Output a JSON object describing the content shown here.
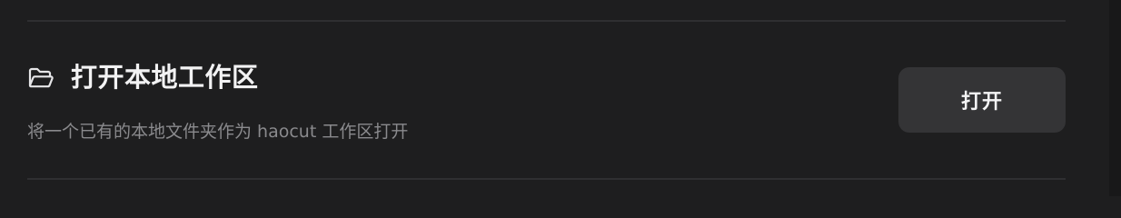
{
  "section": {
    "title": "打开本地工作区",
    "description": "将一个已有的本地文件夹作为 haocut 工作区打开",
    "icon": "folder-open-icon",
    "action_label": "打开"
  },
  "colors": {
    "background": "#1e1e1f",
    "title": "#f2f2f3",
    "description": "#8a8a8d",
    "button_bg": "#343436",
    "divider": "#2f2f31"
  }
}
